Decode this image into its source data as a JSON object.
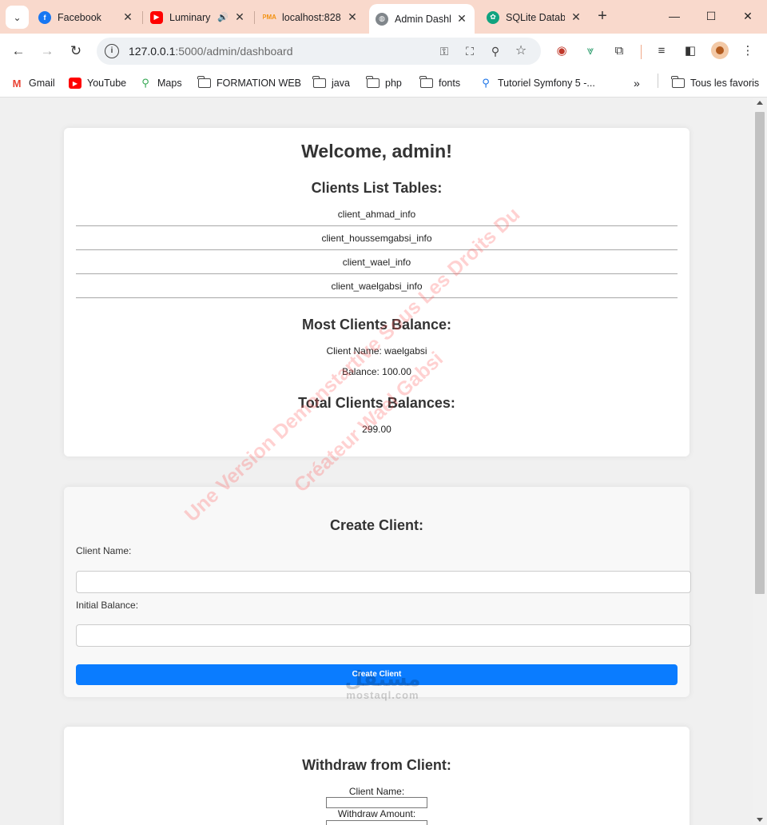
{
  "browser": {
    "tabs": [
      {
        "title": "Facebook",
        "icon": "facebook-icon",
        "color": "#1877f2"
      },
      {
        "title": "Luminary",
        "icon": "youtube-icon",
        "color": "#ff0000",
        "audio": true
      },
      {
        "title": "localhost:828",
        "icon": "phpmyadmin-icon",
        "color": "#f29111"
      },
      {
        "title": "Admin Dashb",
        "icon": "globe-icon",
        "color": "#5f6368",
        "active": true
      },
      {
        "title": "SQLite Datab",
        "icon": "chatgpt-icon",
        "color": "#10a37f"
      }
    ],
    "url_host": "127.0.0.1",
    "url_path": ":5000/admin/dashboard",
    "bookmarks": [
      {
        "label": "Gmail",
        "icon": "gmail-icon"
      },
      {
        "label": "YouTube",
        "icon": "youtube-icon"
      },
      {
        "label": "Maps",
        "icon": "maps-icon"
      },
      {
        "label": "FORMATION WEB",
        "icon": "folder-icon"
      },
      {
        "label": "java",
        "icon": "folder-icon"
      },
      {
        "label": "php",
        "icon": "folder-icon"
      },
      {
        "label": "fonts",
        "icon": "folder-icon"
      },
      {
        "label": "Tutoriel Symfony 5 -...",
        "icon": "search-icon"
      }
    ],
    "all_bookmarks": "Tous les favoris"
  },
  "dashboard": {
    "welcome": "Welcome, admin!",
    "clients_list_title": "Clients List Tables:",
    "client_tables": [
      "client_ahmad_info",
      "client_houssemgabsi_info",
      "client_wael_info",
      "client_waelgabsi_info"
    ],
    "most_balance_title": "Most Clients Balance:",
    "most_client_name": "Client Name: waelgabsi",
    "most_client_balance": "Balance: 100.00",
    "total_title": "Total Clients Balances:",
    "total_value": "299.00"
  },
  "create_client": {
    "title": "Create Client:",
    "name_label": "Client Name:",
    "balance_label": "Initial Balance:",
    "button": "Create Client"
  },
  "withdraw": {
    "title": "Withdraw from Client:",
    "name_label": "Client Name:",
    "amount_label": "Withdraw Amount:"
  },
  "watermark": {
    "line1": "Une Version Demonstartive Sous Les Droits Du",
    "line2": "Créateur Wael Gabsi",
    "logo_arabic": "مستقل",
    "logo_latin": "mostaql.com"
  }
}
